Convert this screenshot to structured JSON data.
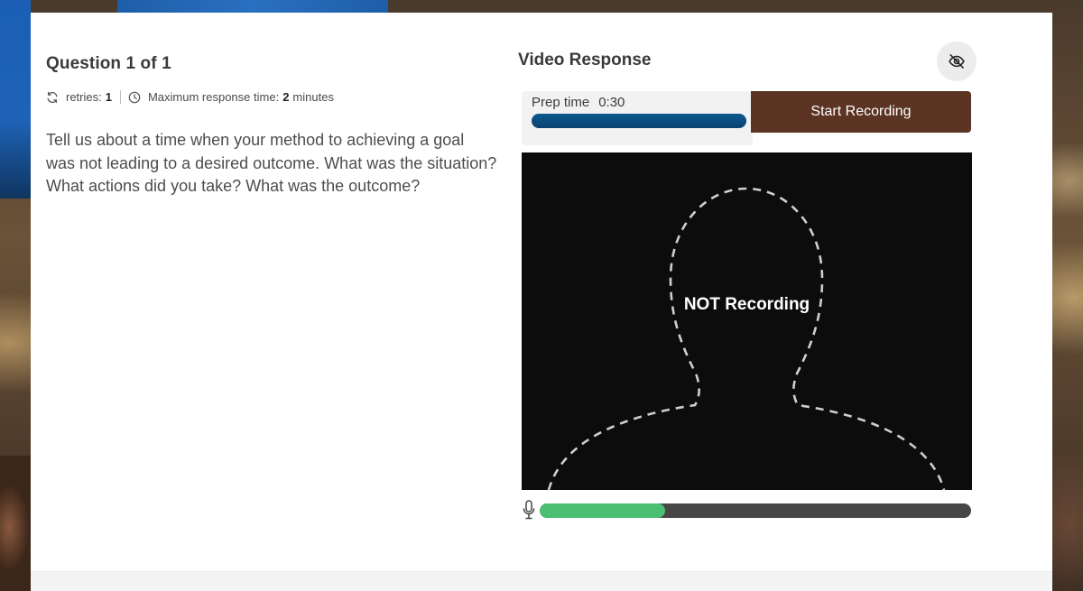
{
  "question": {
    "title": "Question 1 of 1",
    "retries_label": "retries:",
    "retries_value": "1",
    "max_time_label": "Maximum response time:",
    "max_time_value": "2",
    "max_time_unit": "minutes",
    "text": "Tell us about a time when your method to achieving a goal was not leading to a desired outcome. What was the situation? What actions did you take? What was the outcome?"
  },
  "video_response": {
    "title": "Video Response",
    "prep_label": "Prep time",
    "prep_time": "0:30",
    "prep_progress": 1.0,
    "start_button": "Start Recording",
    "status": "NOT Recording",
    "audio_level": 0.29
  },
  "colors": {
    "accent_button": "#5b3424",
    "prep_bar": "#0b4f7e",
    "audio_level": "#4cbf73",
    "video_bg": "#0c0c0c"
  },
  "icons": [
    "refresh-icon",
    "clock-icon",
    "eye-off-icon",
    "microphone-icon"
  ]
}
